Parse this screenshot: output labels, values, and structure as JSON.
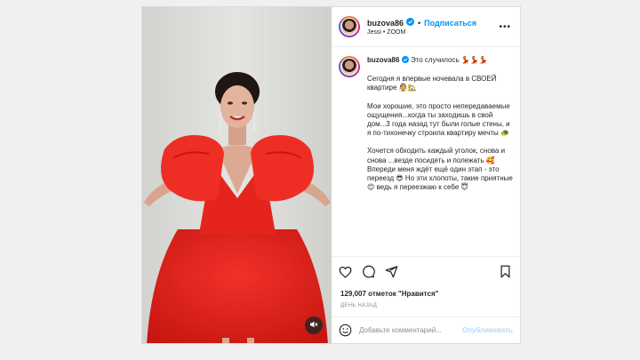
{
  "header": {
    "username": "buzova86",
    "follow_label": "Подписаться",
    "dot": "•",
    "audio_info": "Jessi • ZOOM",
    "more_label": "•••"
  },
  "caption": {
    "username": "buzova86",
    "first_line": "Это случилось 💃💃💃",
    "paragraphs": [
      "Сегодня я впервые ночевала в СВОЕЙ квартире 👰🏡",
      "Мои хорошие, это просто непередаваемые ощущения...когда ты заходишь в свой дом...3 года назад тут были голые стены, и я по-тихонечку строила квартиру мечты 🐢",
      "Хочется обходить каждый уголок, снова и снова ...везде посидеть и полежать 🥰 Впереди меня ждёт ещё один этап - это переезд 😎 Но эти хлопоты, такие приятные 😊 ведь я переезжаю к себе 😇"
    ]
  },
  "stats": {
    "likes": "129,007 отметок \"Нравится\"",
    "time": "ДЕНЬ НАЗАД"
  },
  "comment": {
    "placeholder": "Добавьте комментарий...",
    "publish_label": "Опубликовать"
  },
  "icons": {
    "like": "heart-icon",
    "comment": "comment-icon",
    "share": "share-icon",
    "save": "bookmark-icon",
    "emoji": "emoji-icon",
    "mute": "speaker-mute-icon",
    "verified": "verified-badge-icon"
  },
  "colors": {
    "accent": "#0095f6",
    "dress": "#e8231c",
    "background": "#f0f0f0"
  }
}
